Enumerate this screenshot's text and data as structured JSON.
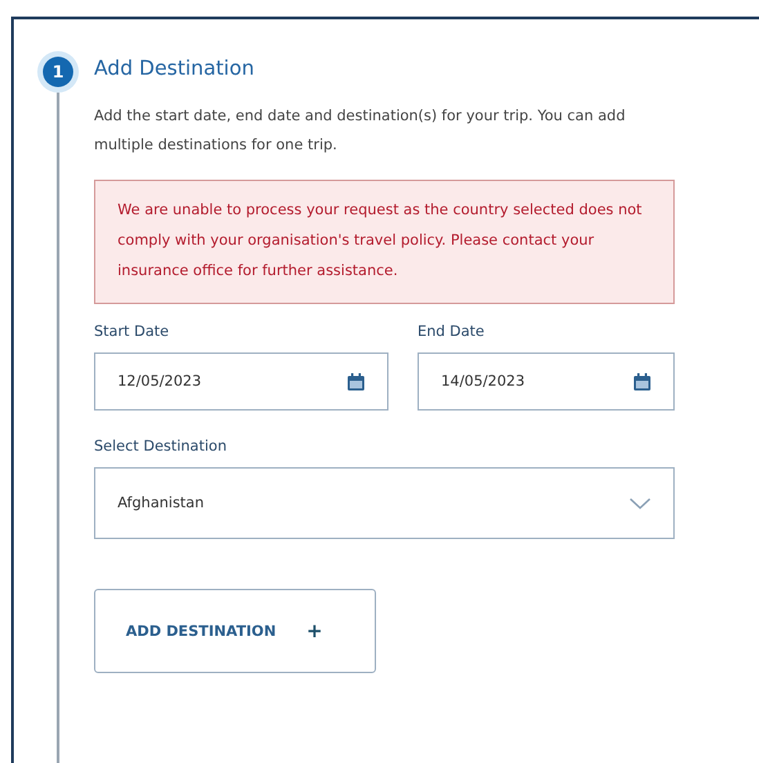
{
  "step": {
    "number": "1",
    "title": "Add Destination",
    "description": "Add the start date, end date and destination(s) for your trip. You can add multiple destinations for one trip."
  },
  "error": {
    "message": "We are unable to process your request as the country selected does not comply with your organisation's travel policy. Please contact your insurance office for further assistance."
  },
  "dates": [
    {
      "label": "Start Date",
      "value": "12/05/2023"
    },
    {
      "label": "End Date",
      "value": "14/05/2023"
    }
  ],
  "destination": {
    "label": "Select Destination",
    "value": "Afghanistan"
  },
  "add_button": {
    "label": "ADD DESTINATION",
    "icon": "+"
  }
}
